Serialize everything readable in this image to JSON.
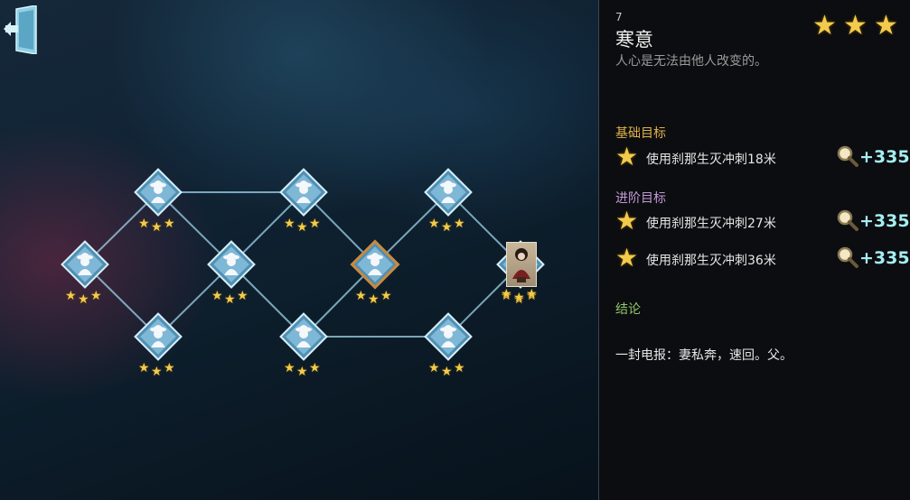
{
  "level": {
    "number": "7",
    "title": "寒意",
    "subtitle": "人心是无法由他人改变的。",
    "star_rating": 3
  },
  "objectives": {
    "basic_header": "基础目标",
    "advanced_header": "进阶目标",
    "basic": [
      {
        "text": "使用刹那生灭冲刺18米",
        "reward": "+335",
        "stars": 1
      }
    ],
    "advanced": [
      {
        "text": "使用刹那生灭冲刺27米",
        "reward": "+335",
        "stars": 1
      },
      {
        "text": "使用刹那生灭冲刺36米",
        "reward": "+335",
        "stars": 1
      }
    ]
  },
  "conclusion": {
    "header": "结论",
    "text": "一封电报：妻私奔，速回。父。"
  },
  "map": {
    "nodes": [
      {
        "id": "n1",
        "stars": 3
      },
      {
        "id": "n2",
        "stars": 3
      },
      {
        "id": "n3",
        "stars": 3
      },
      {
        "id": "n4",
        "stars": 3
      },
      {
        "id": "n5",
        "stars": 3
      },
      {
        "id": "n6",
        "stars": 3
      },
      {
        "id": "n7",
        "stars": 3,
        "selected": true
      },
      {
        "id": "n8",
        "stars": 3
      },
      {
        "id": "n9",
        "stars": 3
      },
      {
        "id": "n10",
        "stars": 3
      },
      {
        "id": "n11",
        "stars": 3,
        "current_character": true
      }
    ]
  },
  "icons": {
    "exit": "exit-door-icon",
    "node": "detective-silhouette-icon",
    "reward": "magnifier-icon",
    "star": "star-icon"
  },
  "colors": {
    "star": "#f2cb4c",
    "reward": "#a6eef2",
    "basic_header": "#e0b24a",
    "advanced_header": "#c39ad8",
    "conclusion_header": "#8fc66a",
    "node_fill": "#7fb7d6",
    "selected_border": "#c98a3e"
  }
}
